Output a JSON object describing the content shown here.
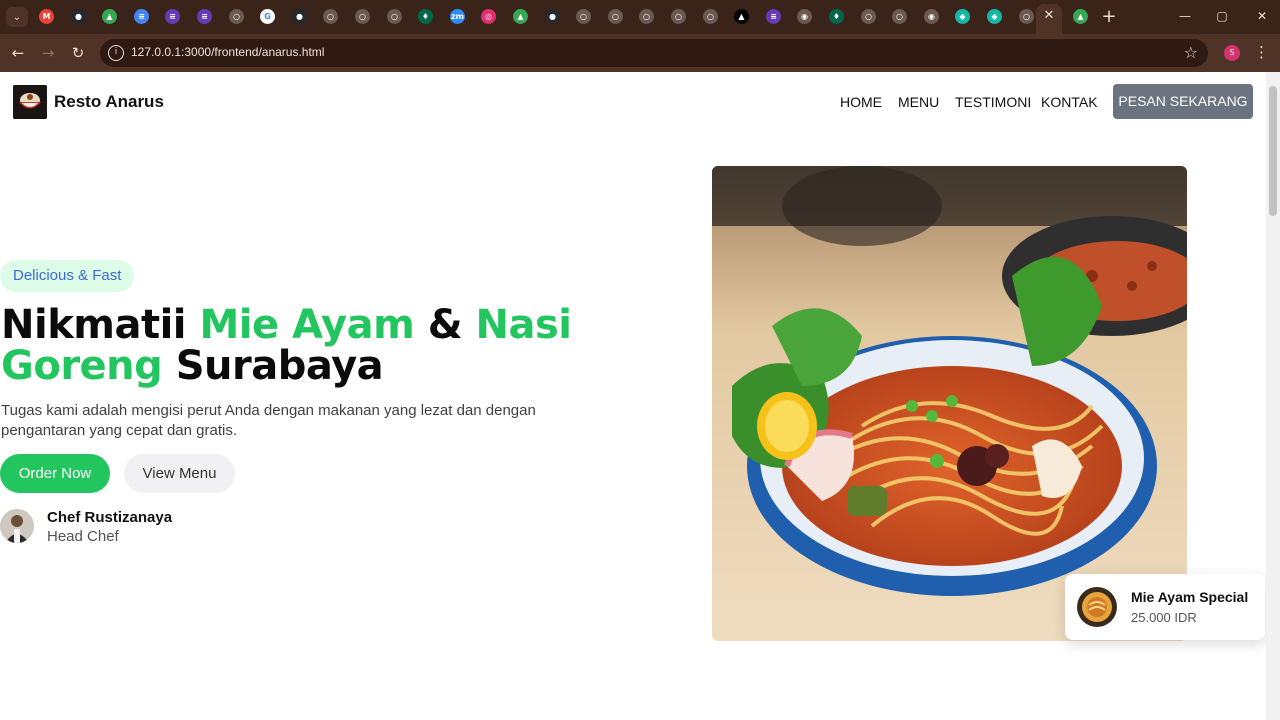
{
  "browser": {
    "url": "127.0.0.1:3000/frontend/anarus.html",
    "profile_initial": "S",
    "tabs": [
      {
        "icon": "gmail-icon",
        "color": "#ea4335",
        "glyph": "M"
      },
      {
        "icon": "github-icon",
        "color": "#24292f",
        "glyph": "●"
      },
      {
        "icon": "google-drive-icon",
        "color": "#34a853",
        "glyph": "▲"
      },
      {
        "icon": "google-docs-icon",
        "color": "#4285f4",
        "glyph": "≡"
      },
      {
        "icon": "google-forms-icon",
        "color": "#673ab7",
        "glyph": "≡"
      },
      {
        "icon": "google-forms-icon",
        "color": "#673ab7",
        "glyph": "≡"
      },
      {
        "icon": "globe-icon",
        "color": "#6b5a52",
        "glyph": "○"
      },
      {
        "icon": "google-icon",
        "color": "#ffffff",
        "glyph": "G"
      },
      {
        "icon": "github-icon",
        "color": "#24292f",
        "glyph": "●"
      },
      {
        "icon": "globe-icon",
        "color": "#6b5a52",
        "glyph": "○"
      },
      {
        "icon": "globe-icon",
        "color": "#6b5a52",
        "glyph": "○"
      },
      {
        "icon": "globe-icon",
        "color": "#6b5a52",
        "glyph": "○"
      },
      {
        "icon": "mongodb-icon",
        "color": "#00684a",
        "glyph": "♦"
      },
      {
        "icon": "zoom-icon",
        "color": "#2d8cff",
        "glyph": "zm"
      },
      {
        "icon": "instagram-icon",
        "color": "#e1306c",
        "glyph": "◎"
      },
      {
        "icon": "google-drive-icon",
        "color": "#34a853",
        "glyph": "▲"
      },
      {
        "icon": "github-icon",
        "color": "#24292f",
        "glyph": "●"
      },
      {
        "icon": "globe-icon",
        "color": "#6b5a52",
        "glyph": "○"
      },
      {
        "icon": "globe-icon",
        "color": "#6b5a52",
        "glyph": "○"
      },
      {
        "icon": "globe-icon",
        "color": "#6b5a52",
        "glyph": "○"
      },
      {
        "icon": "globe-icon",
        "color": "#6b5a52",
        "glyph": "○"
      },
      {
        "icon": "globe-icon",
        "color": "#6b5a52",
        "glyph": "○"
      },
      {
        "icon": "vercel-icon",
        "color": "#000000",
        "glyph": "▲"
      },
      {
        "icon": "google-forms-icon",
        "color": "#673ab7",
        "glyph": "≡"
      },
      {
        "icon": "chrome-icon",
        "color": "#6b5a52",
        "glyph": "◉"
      },
      {
        "icon": "mongodb-icon",
        "color": "#00684a",
        "glyph": "♦"
      },
      {
        "icon": "globe-icon",
        "color": "#6b5a52",
        "glyph": "○"
      },
      {
        "icon": "globe-icon",
        "color": "#6b5a52",
        "glyph": "○"
      },
      {
        "icon": "chrome-icon",
        "color": "#6b5a52",
        "glyph": "◉"
      },
      {
        "icon": "diamond-icon",
        "color": "#14b8a6",
        "glyph": "◆"
      },
      {
        "icon": "diamond-icon",
        "color": "#14b8a6",
        "glyph": "◆"
      },
      {
        "icon": "globe-icon",
        "color": "#6b5a52",
        "glyph": "○"
      }
    ],
    "extra_tab": {
      "icon": "google-drive-icon",
      "color": "#34a853",
      "glyph": "▲"
    }
  },
  "site": {
    "brand": "Resto Anarus",
    "nav": [
      "HOME",
      "MENU",
      "TESTIMONI",
      "KONTAK"
    ],
    "cta": "PESAN SEKARANG"
  },
  "hero": {
    "badge": "Delicious & Fast",
    "headline": {
      "part1": "Nikmatii ",
      "highlight1": "Mie Ayam",
      "part2": " & ",
      "highlight2": "Nasi Goreng",
      "part3": " Surabaya"
    },
    "description": "Tugas kami adalah mengisi perut Anda dengan makanan yang lezat dan dengan pengantaran yang cepat dan gratis.",
    "order_button": "Order Now",
    "menu_button": "View Menu",
    "chef_name": "Chef Rustizanaya",
    "chef_role": "Head Chef"
  },
  "featured": {
    "title": "Mie Ayam Special",
    "price": "25.000 IDR"
  },
  "colors": {
    "accent_green": "#22c55e",
    "badge_bg": "#dcfce7",
    "badge_text": "#3b6bd6",
    "cta_gray": "#6b7280",
    "chrome_brown": "#3a2318"
  }
}
